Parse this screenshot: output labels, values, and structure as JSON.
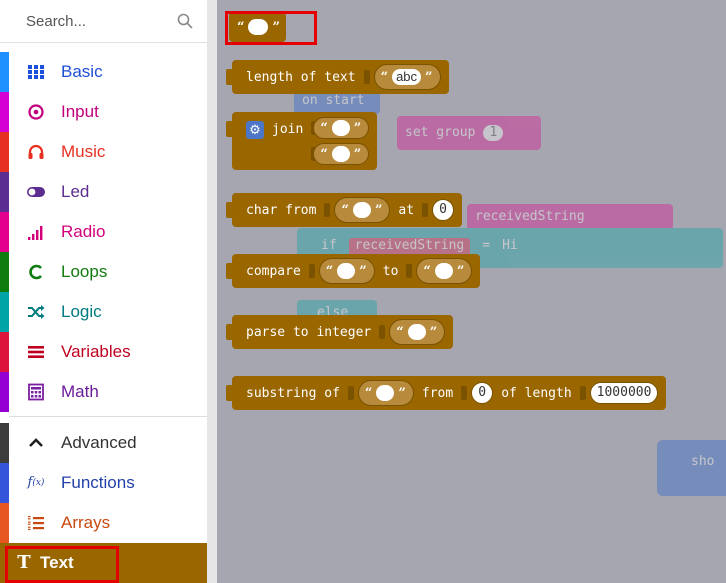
{
  "search": {
    "placeholder": "Search..."
  },
  "categories": [
    {
      "label": "Basic",
      "color": "#1e90ff",
      "icon": "grid-icon"
    },
    {
      "label": "Input",
      "color": "#d400d4",
      "icon": "target-icon"
    },
    {
      "label": "Music",
      "color": "#e63022",
      "icon": "headphones-icon"
    },
    {
      "label": "Led",
      "color": "#5c2d91",
      "icon": "toggle-icon"
    },
    {
      "label": "Radio",
      "color": "#e3008c",
      "icon": "signal-icon"
    },
    {
      "label": "Loops",
      "color": "#107c10",
      "icon": "loop-icon"
    },
    {
      "label": "Logic",
      "color": "#00a4a6",
      "icon": "shuffle-icon"
    },
    {
      "label": "Variables",
      "color": "#dc143c",
      "icon": "list-icon"
    },
    {
      "label": "Math",
      "color": "#9400d3",
      "icon": "calculator-icon"
    },
    {
      "label": "Advanced",
      "color": "#3c3c3c",
      "icon": "chevron-up-icon"
    },
    {
      "label": "Functions",
      "color": "#3455db",
      "icon": "function-icon"
    },
    {
      "label": "Arrays",
      "color": "#e65722",
      "icon": "array-icon"
    },
    {
      "label": "Text",
      "color": "#996600",
      "icon": "text-icon"
    }
  ],
  "blocks": {
    "length": {
      "text": "length of text",
      "value": "abc"
    },
    "join": {
      "text": "join"
    },
    "char_from": {
      "text": "char from",
      "at": "at",
      "index": "0"
    },
    "compare": {
      "text": "compare",
      "to": "to"
    },
    "parse": {
      "text": "parse to integer"
    },
    "substring": {
      "text": "substring of",
      "from": "from",
      "from_value": "0",
      "of_length": "of length",
      "length_value": "1000000"
    }
  },
  "ghost": {
    "on_start": "on start",
    "set_group": "set group",
    "group_value": "1",
    "variable": "receivedString",
    "if_label": "if",
    "eq": "=",
    "hi": "Hi",
    "else_label": "else",
    "show": "sho"
  }
}
